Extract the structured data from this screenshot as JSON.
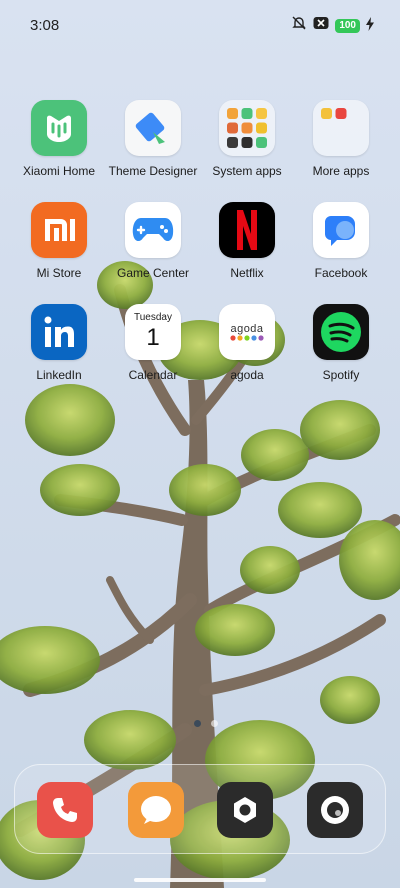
{
  "status_bar": {
    "time": "3:08",
    "battery": "100"
  },
  "apps": [
    {
      "label": "Xiaomi Home",
      "icon": "xiaomi-home-icon"
    },
    {
      "label": "Theme Designer",
      "icon": "theme-designer-icon"
    },
    {
      "label": "System apps",
      "icon": "system-apps-folder-icon"
    },
    {
      "label": "More apps",
      "icon": "more-apps-folder-icon"
    },
    {
      "label": "Mi Store",
      "icon": "mi-store-icon"
    },
    {
      "label": "Game Center",
      "icon": "game-center-icon"
    },
    {
      "label": "Netflix",
      "icon": "netflix-icon"
    },
    {
      "label": "Facebook",
      "icon": "facebook-icon"
    },
    {
      "label": "LinkedIn",
      "icon": "linkedin-icon"
    },
    {
      "label": "Calendar",
      "icon": "calendar-icon"
    },
    {
      "label": "agoda",
      "icon": "agoda-icon"
    },
    {
      "label": "Spotify",
      "icon": "spotify-icon"
    }
  ],
  "calendar_widget": {
    "weekday": "Tuesday",
    "day": "1"
  },
  "agoda_logo_text": "agoda",
  "dock": [
    {
      "icon": "phone-icon"
    },
    {
      "icon": "messages-icon"
    },
    {
      "icon": "settings-icon"
    },
    {
      "icon": "camera-icon"
    }
  ],
  "page_indicator": {
    "pages": 2,
    "current": 1
  },
  "colors": {
    "xiaomi_home": "#4cc27a",
    "mi_store": "#f26b21",
    "netflix_red": "#e50914",
    "linkedin": "#0a66c2",
    "spotify_green": "#1ed760",
    "battery": "#34c759"
  }
}
